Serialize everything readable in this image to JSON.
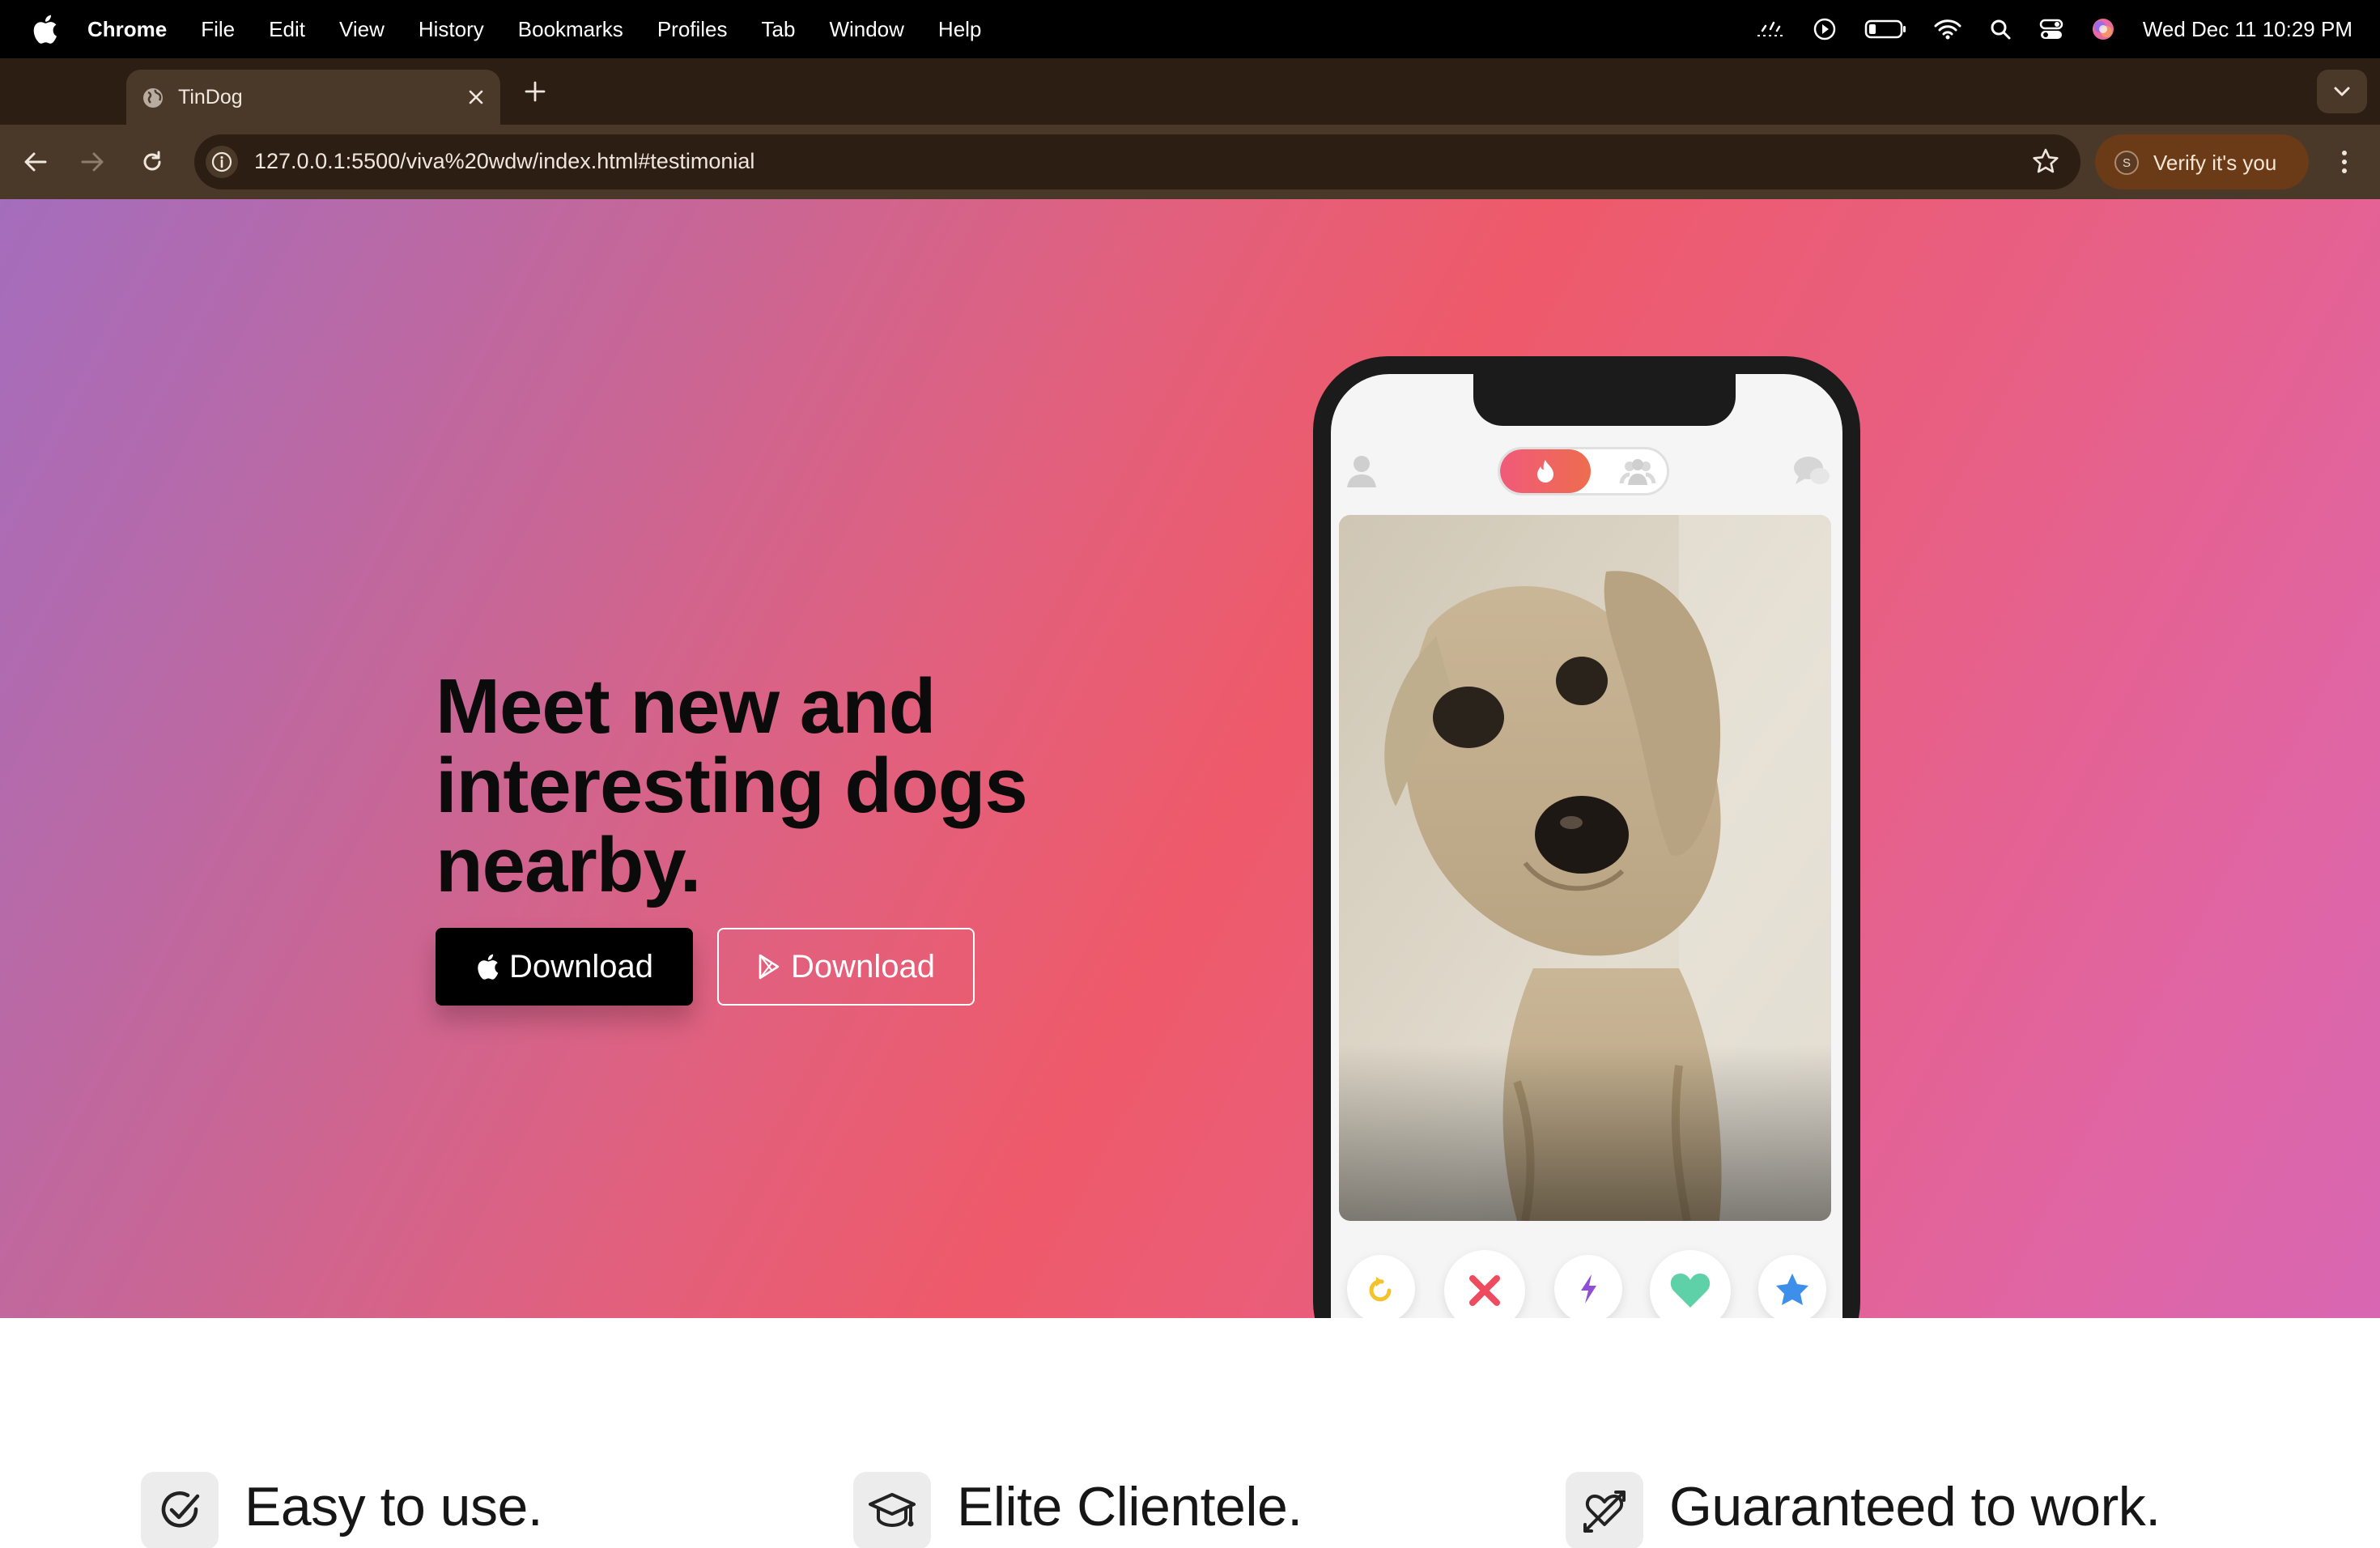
{
  "menubar": {
    "app_name": "Chrome",
    "items": [
      "File",
      "Edit",
      "View",
      "History",
      "Bookmarks",
      "Profiles",
      "Tab",
      "Window",
      "Help"
    ],
    "datetime": "Wed Dec 11  10:29 PM"
  },
  "tab": {
    "title": "TinDog"
  },
  "toolbar": {
    "url": "127.0.0.1:5500/viva%20wdw/index.html#testimonial",
    "verify_label": "Verify it's you",
    "profile_initial": "S"
  },
  "hero": {
    "headline": "Meet new and interesting dogs nearby.",
    "apple_download_label": "Download",
    "play_download_label": "Download",
    "gradient": [
      "#a46dbd",
      "#ee5a6a",
      "#d866b2"
    ]
  },
  "features": [
    {
      "title": "Easy to use.",
      "icon": "circle-check-icon"
    },
    {
      "title": "Elite Clientele.",
      "icon": "graduation-cap-icon"
    },
    {
      "title": "Guaranteed to work.",
      "icon": "heart-arrow-icon"
    }
  ],
  "colors": {
    "chrome_dark": "#2c1e12",
    "chrome_toolbar": "#4a3829",
    "verify_bg": "#6b3a17",
    "cta_dark": "#000000"
  }
}
